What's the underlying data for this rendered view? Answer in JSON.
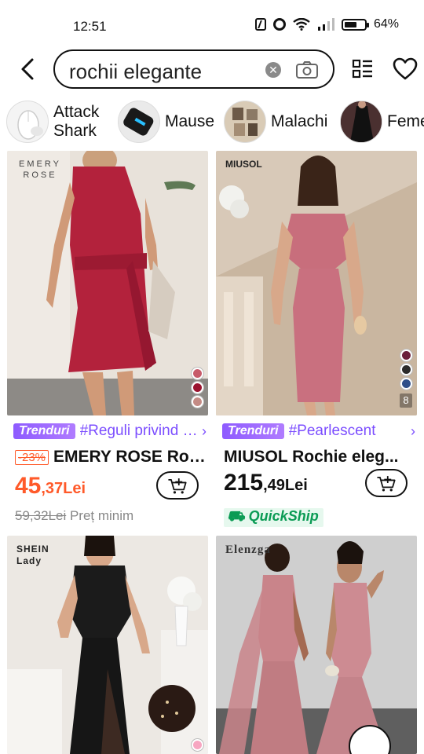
{
  "status": {
    "time": "12:51",
    "battery": "64%",
    "battery_fraction": 0.64
  },
  "search": {
    "query": "rochii elegante"
  },
  "chips": [
    {
      "label": "Attack Shark",
      "thumb": "mouse"
    },
    {
      "label": "Mause",
      "thumb": "keyboard"
    },
    {
      "label": "Malachi",
      "thumb": "photos"
    },
    {
      "label": "Feme",
      "thumb": "dress"
    }
  ],
  "products": [
    {
      "brand_logo": "EMERY ROSE",
      "trend_badge": "Trenduri",
      "trend_tag": "#Reguli privind moda",
      "discount": "-23%",
      "title": "EMERY ROSE Rochie",
      "price_int": "45",
      "price_dec": ",37Lei",
      "old_price": "59,32Lei",
      "note": "Preț minim",
      "swatches": [
        "#c75b6a",
        "#9b1430",
        "#c48b85"
      ],
      "accent": "#ff5a2a"
    },
    {
      "brand_logo": "MIUSOL",
      "trend_badge": "Trenduri",
      "trend_tag": "#Pearlescent",
      "title": "MIUSOL Rochie eleg...",
      "price_int": "215",
      "price_dec": ",49Lei",
      "quickship": "QuickShip",
      "swatches": [
        "#6b1f3b",
        "#2b2b2b",
        "#2f4f8a"
      ],
      "more_colors": "8"
    },
    {
      "brand_logo": "SHEIN Lady"
    },
    {
      "brand_logo": "Elenzga"
    }
  ]
}
